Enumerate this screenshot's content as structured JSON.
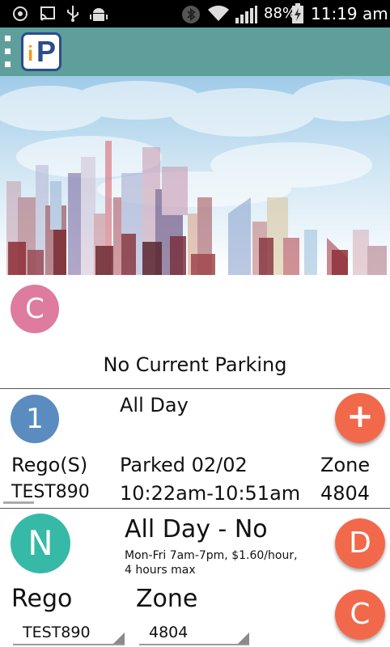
{
  "status_bar": {
    "icons": [
      "target-icon",
      "cast-icon",
      "usb-icon",
      "android-debug-icon",
      "bluetooth-icon",
      "wifi-icon",
      "signal-icon",
      "battery-icon"
    ],
    "battery": "88%",
    "time": "11:19 am"
  },
  "app_bar": {
    "logo_i": "i",
    "logo_p": "P"
  },
  "current_parking": {
    "avatar_letter": "C",
    "message": "No Current Parking"
  },
  "history_item": {
    "avatar_number": "1",
    "title": "All Day",
    "add_symbol": "+",
    "rego_label": "Rego(S)",
    "rego_value": "TEST890",
    "parked_label": "Parked 02/02",
    "time_range": "10:22am-10:51am",
    "zone_label": "Zone",
    "zone_value": "4804"
  },
  "new_parking": {
    "avatar_letter": "N",
    "title": "All Day - No",
    "rate_line1": "Mon-Fri 7am-7pm, $1.60/hour,",
    "rate_line2": "4 hours max",
    "d_button": "D",
    "c_button": "C",
    "rego_label": "Rego",
    "zone_label": "Zone",
    "rego_selected": "TEST890",
    "zone_selected": "4804"
  },
  "colors": {
    "app_bar": "#5f9f9b",
    "fab": "#f2684b",
    "avatar_c": "#de7b9e",
    "avatar_1": "#5b8cbf",
    "avatar_n": "#36b9a7"
  }
}
